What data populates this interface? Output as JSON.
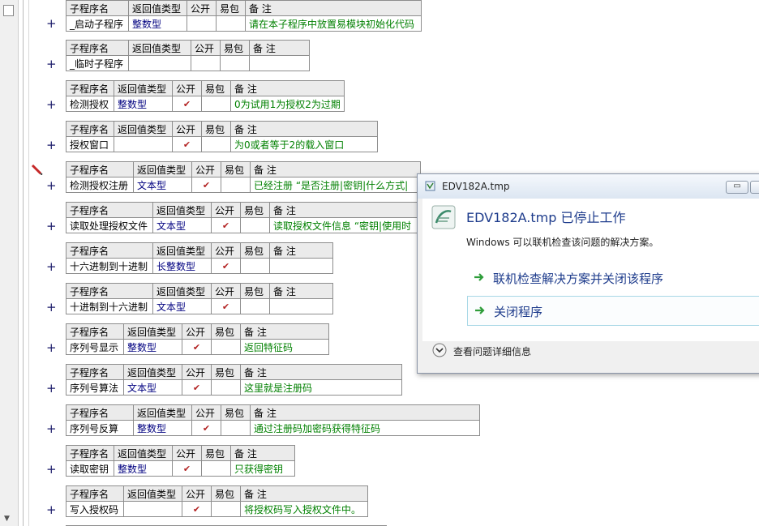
{
  "headers": {
    "name": "子程序名",
    "return_type": "返回值类型",
    "public": "公开",
    "package": "易包",
    "remark": "备 注"
  },
  "public_mark": "✔",
  "subs": [
    {
      "name": "_启动子程序",
      "type": "整数型",
      "public": false,
      "remark": "请在本子程序中放置易模块初始化代码"
    },
    {
      "name": "_临时子程序",
      "type": "",
      "public": false,
      "remark": ""
    },
    {
      "name": "检测授权",
      "type": "整数型",
      "public": true,
      "remark": "0为试用1为授权2为过期"
    },
    {
      "name": "授权窗口",
      "type": "",
      "public": true,
      "remark": "为0或者等于2的载入窗口"
    },
    {
      "name": "检测授权注册",
      "type": "文本型",
      "public": true,
      "remark": "已经注册 “是否注册|密钥|什么方式|"
    },
    {
      "name": "读取处理授权文件",
      "type": "文本型",
      "public": true,
      "remark": "读取授权文件信息 “密钥|使用时"
    },
    {
      "name": "十六进制到十进制",
      "type": "长整数型",
      "public": true,
      "remark": ""
    },
    {
      "name": "十进制到十六进制",
      "type": "文本型",
      "public": true,
      "remark": ""
    },
    {
      "name": "序列号显示",
      "type": "整数型",
      "public": true,
      "remark": "返回特征码"
    },
    {
      "name": "序列号算法",
      "type": "文本型",
      "public": true,
      "remark": "这里就是注册码"
    },
    {
      "name": "序列号反算",
      "type": "整数型",
      "public": true,
      "remark": "通过注册码加密码获得特征码"
    },
    {
      "name": "读取密钥",
      "type": "整数型",
      "public": true,
      "remark": "只获得密钥"
    },
    {
      "name": "写入授权码",
      "type": "",
      "public": true,
      "remark": "将授权码写入授权文件中。"
    }
  ],
  "dialog": {
    "title": "EDV182A.tmp",
    "heading": "EDV182A.tmp 已停止工作",
    "description": "Windows 可以联机检查该问题的解决方案。",
    "option_online": "联机检查解决方案并关闭该程序",
    "option_close": "关闭程序",
    "details": "查看问题详细信息"
  },
  "colors": {
    "type_text": "#000080",
    "remark_text": "#008000",
    "check": "#b22222",
    "dialog_heading": "#1e3c8c"
  }
}
